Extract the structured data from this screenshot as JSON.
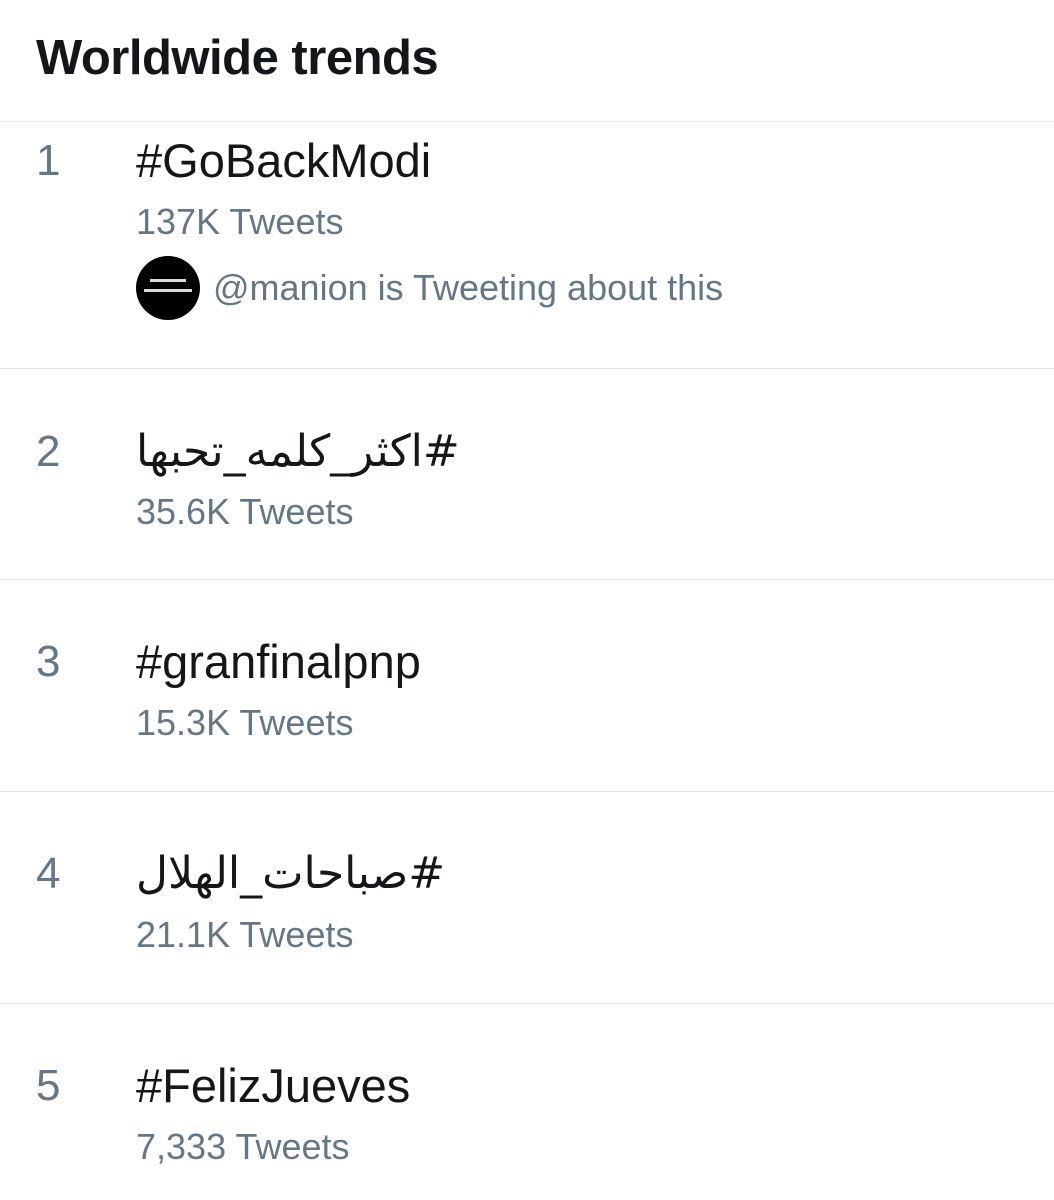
{
  "header": {
    "title": "Worldwide trends"
  },
  "trends": [
    {
      "rank": "1",
      "hashtag": "#GoBackModi",
      "tweet_count": "137K Tweets",
      "context": {
        "avatar_icon": "profile-avatar-icon",
        "text": "@manion is Tweeting about this"
      }
    },
    {
      "rank": "2",
      "hashtag": "#اكثر_كلمه_تحبها",
      "tweet_count": "35.6K Tweets"
    },
    {
      "rank": "3",
      "hashtag": "#granfinalpnp",
      "tweet_count": "15.3K Tweets"
    },
    {
      "rank": "4",
      "hashtag": "#صباحات_الهلال",
      "tweet_count": "21.1K Tweets"
    },
    {
      "rank": "5",
      "hashtag": "#FelizJueves",
      "tweet_count": "7,333 Tweets"
    }
  ],
  "colors": {
    "primary_text": "#14171a",
    "secondary_text": "#657786",
    "divider": "#e1e8ed",
    "background": "#ffffff"
  }
}
